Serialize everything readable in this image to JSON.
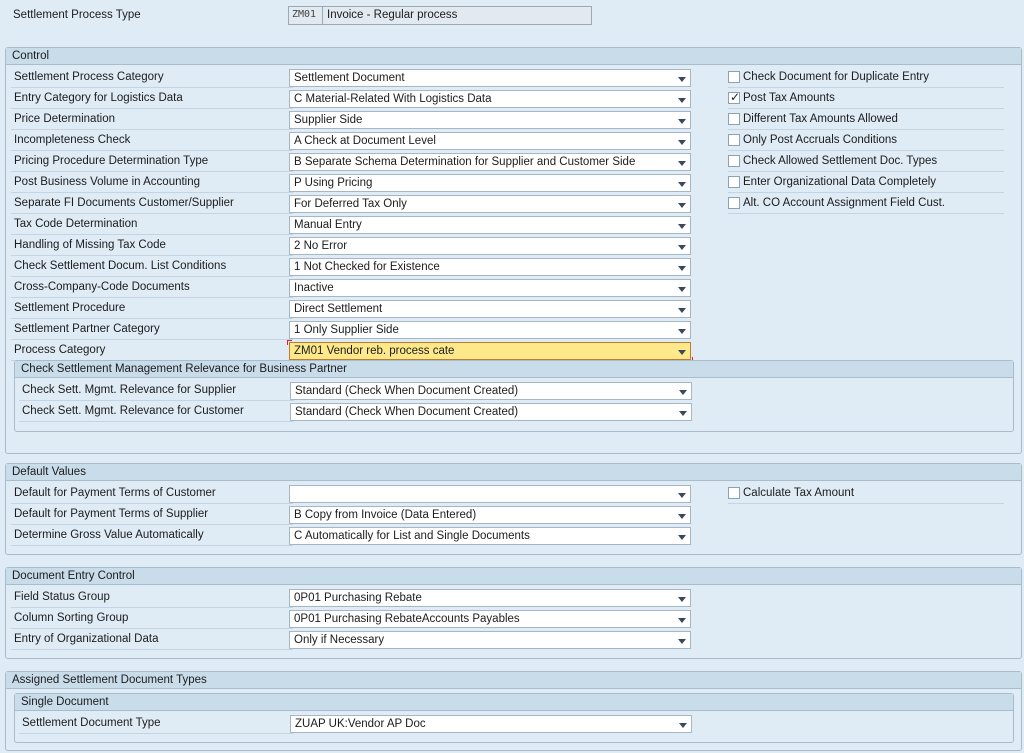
{
  "header": {
    "label": "Settlement Process Type",
    "code": "ZM01",
    "description": "Invoice - Regular process"
  },
  "control": {
    "title": "Control",
    "rows": [
      {
        "label": "Settlement Process Category",
        "value": "Settlement Document"
      },
      {
        "label": "Entry Category for Logistics Data",
        "value": "C Material-Related With Logistics Data"
      },
      {
        "label": "Price Determination",
        "value": "Supplier Side"
      },
      {
        "label": "Incompleteness Check",
        "value": "A Check at Document Level"
      },
      {
        "label": "Pricing Procedure Determination Type",
        "value": "B Separate Schema Determination for Supplier and Customer Side"
      },
      {
        "label": "Post Business Volume in Accounting",
        "value": "P Using Pricing"
      },
      {
        "label": "Separate FI Documents Customer/Supplier",
        "value": "For Deferred Tax Only"
      },
      {
        "label": "Tax Code Determination",
        "value": "Manual Entry"
      },
      {
        "label": "Handling of Missing Tax Code",
        "value": "2 No Error"
      },
      {
        "label": "Check Settlement Docum. List Conditions",
        "value": "1 Not Checked for Existence"
      },
      {
        "label": "Cross-Company-Code Documents",
        "value": "Inactive"
      },
      {
        "label": "Settlement Procedure",
        "value": "Direct Settlement"
      },
      {
        "label": "Settlement Partner Category",
        "value": "1 Only Supplier Side"
      },
      {
        "label": "Process Category",
        "value": "ZM01 Vendor reb. process cate"
      }
    ],
    "checkboxes": [
      {
        "label": "Check Document for Duplicate Entry",
        "checked": false
      },
      {
        "label": "Post Tax Amounts",
        "checked": true
      },
      {
        "label": "Different Tax Amounts Allowed",
        "checked": false
      },
      {
        "label": "Only Post Accruals Conditions",
        "checked": false
      },
      {
        "label": "Check Allowed Settlement Doc. Types",
        "checked": false
      },
      {
        "label": "Enter Organizational Data Completely",
        "checked": false
      },
      {
        "label": "Alt. CO Account Assignment Field Cust.",
        "checked": false
      }
    ],
    "relevance": {
      "title": "Check Settlement Management Relevance for Business Partner",
      "rows": [
        {
          "label": "Check Sett. Mgmt. Relevance for Supplier",
          "value": "Standard (Check When Document Created)"
        },
        {
          "label": "Check Sett. Mgmt. Relevance for Customer",
          "value": "Standard (Check When Document Created)"
        }
      ]
    }
  },
  "defaults": {
    "title": "Default Values",
    "rows": [
      {
        "label": "Default for Payment Terms of Customer",
        "value": ""
      },
      {
        "label": "Default for Payment Terms of Supplier",
        "value": "B Copy from Invoice (Data Entered)"
      },
      {
        "label": "Determine Gross Value Automatically",
        "value": "C Automatically for List and Single Documents"
      }
    ],
    "checkbox": {
      "label": "Calculate Tax Amount",
      "checked": false
    }
  },
  "entry_control": {
    "title": "Document Entry Control",
    "rows": [
      {
        "label": "Field Status Group",
        "value": "0P01 Purchasing Rebate"
      },
      {
        "label": "Column Sorting Group",
        "value": "0P01 Purchasing RebateAccounts Payables"
      },
      {
        "label": "Entry of Organizational Data",
        "value": "Only if Necessary"
      }
    ]
  },
  "assigned": {
    "title": "Assigned Settlement Document Types",
    "single": {
      "title": "Single Document",
      "label": "Settlement Document Type",
      "value": "ZUAP UK:Vendor AP Doc"
    }
  },
  "colors": {
    "background": "#dfebf5",
    "group_header": "#c9dcea",
    "highlight_field": "#fde98a"
  }
}
